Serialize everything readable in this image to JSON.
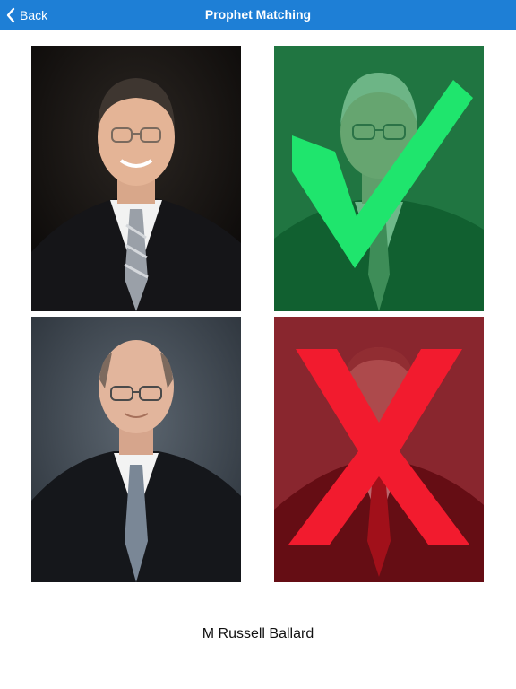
{
  "header": {
    "back_label": "Back",
    "title": "Prophet Matching",
    "background_color": "#1e7fd6"
  },
  "cards": [
    {
      "state": "neutral"
    },
    {
      "state": "correct",
      "mark_icon": "checkmark-icon",
      "mark_color": "#1fe56d"
    },
    {
      "state": "neutral"
    },
    {
      "state": "incorrect",
      "mark_icon": "x-mark-icon",
      "mark_color": "#f21b2e"
    }
  ],
  "answer": {
    "name": "M Russell Ballard"
  }
}
